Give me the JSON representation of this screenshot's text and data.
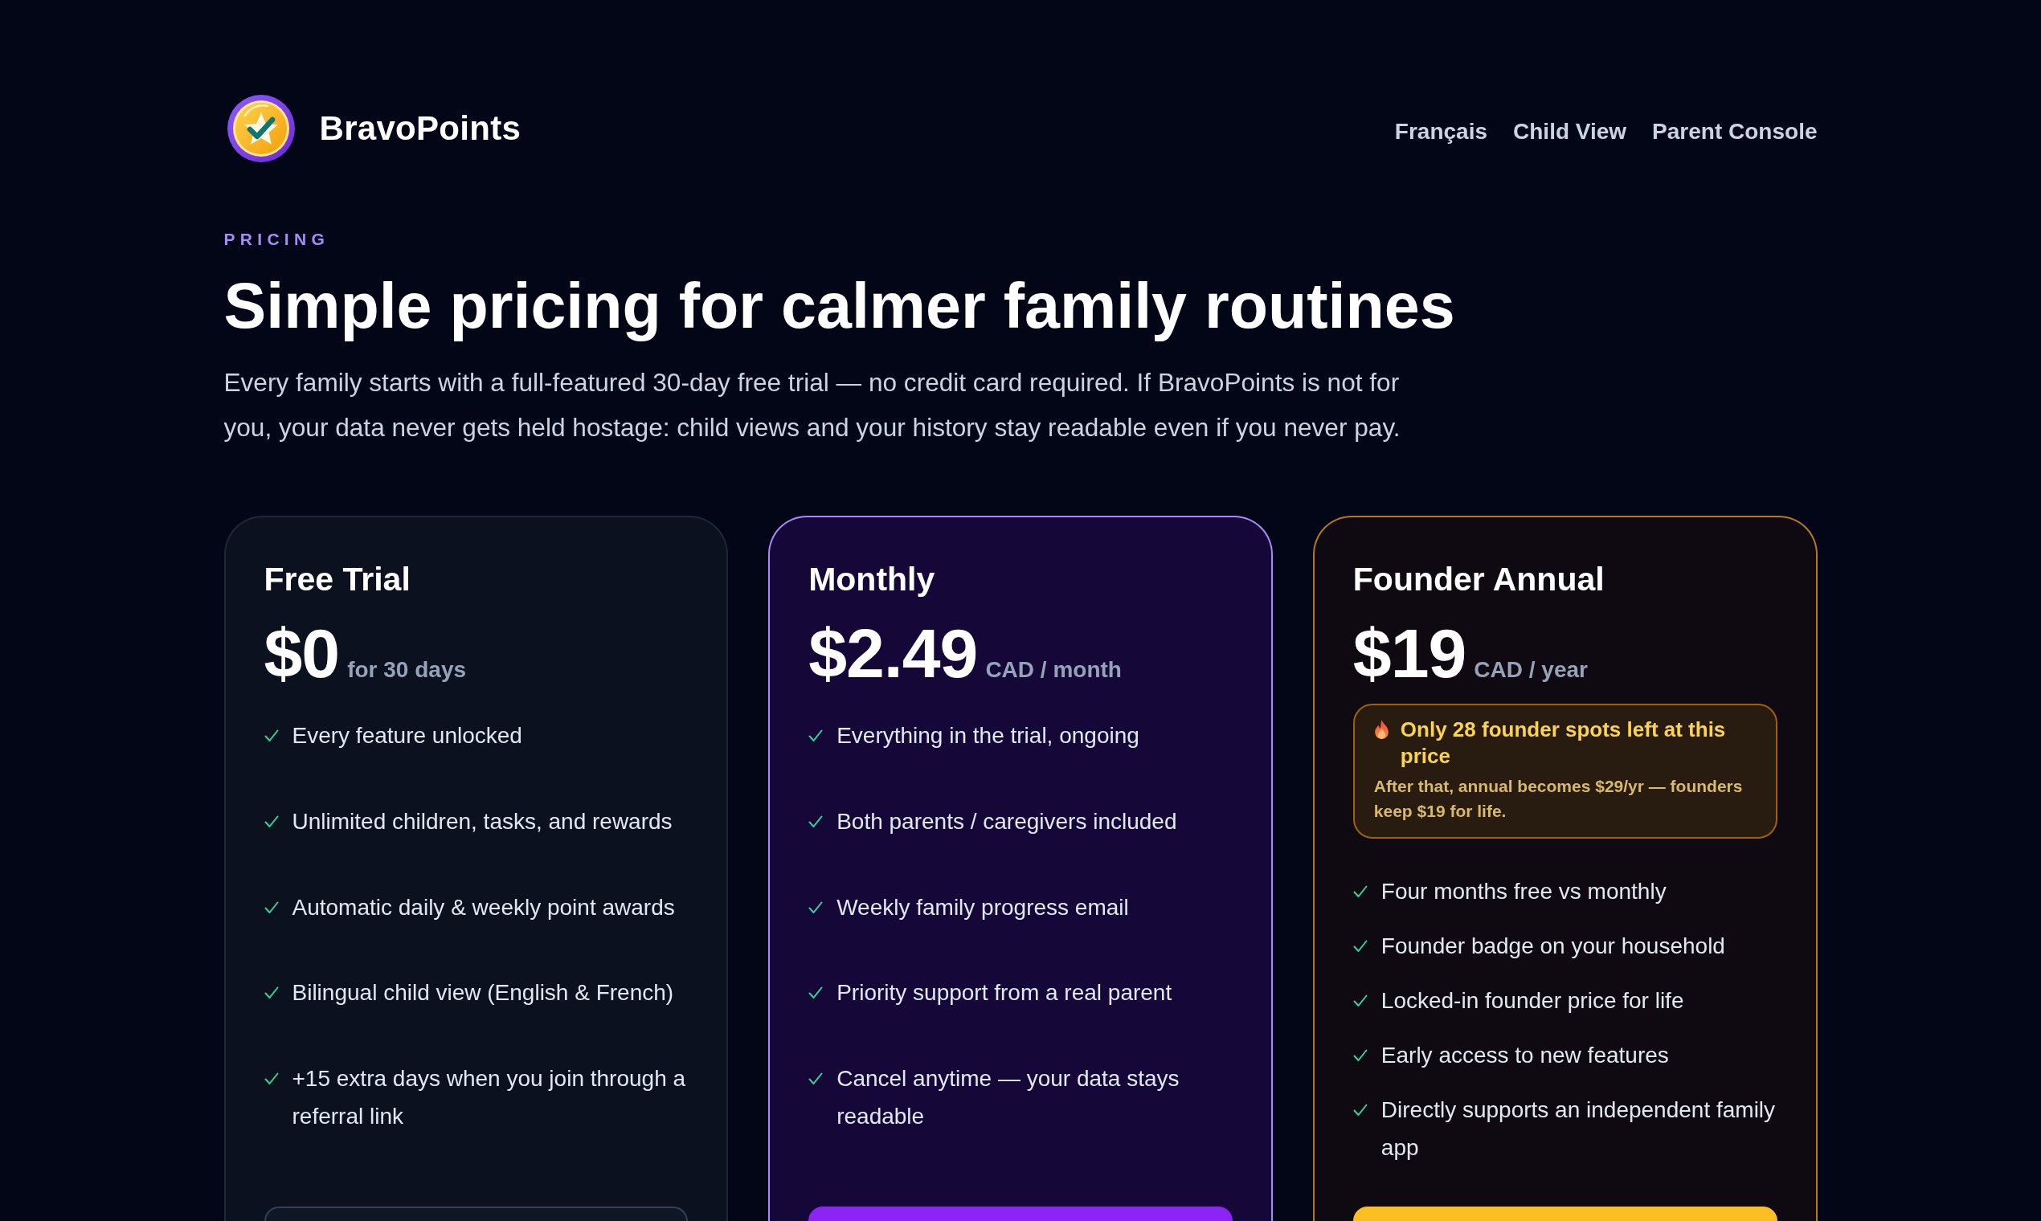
{
  "brand": {
    "name": "BravoPoints"
  },
  "nav": [
    "Français",
    "Child View",
    "Parent Console"
  ],
  "hero": {
    "eyebrow": "PRICING",
    "title": "Simple pricing for calmer family routines",
    "text": "Every family starts with a full-featured 30-day free trial — no credit card required. If BravoPoints is not for you, your data never gets held hostage: child views and your history stay readable even if you never pay."
  },
  "plans": [
    {
      "kind": "basic",
      "name": "Free Trial",
      "price": "$0",
      "period": "for 30 days",
      "features": [
        "Every feature unlocked",
        "Unlimited children, tasks, and rewards",
        "Automatic daily & weekly point awards",
        "Bilingual child view (English & French)",
        "+15 extra days when you join through a referral link"
      ]
    },
    {
      "kind": "featured",
      "name": "Monthly",
      "price": "$2.49",
      "period": "CAD / month",
      "features": [
        "Everything in the trial, ongoing",
        "Both parents / caregivers included",
        "Weekly family progress email",
        "Priority support from a real parent",
        "Cancel anytime — your data stays readable"
      ]
    },
    {
      "kind": "founder",
      "name": "Founder Annual",
      "price": "$19",
      "period": "CAD / year",
      "notice": {
        "title": "Only 28 founder spots left at this price",
        "text": "After that, annual becomes $29/yr — founders keep $19 for life."
      },
      "features": [
        "Four months free vs monthly",
        "Founder badge on your household",
        "Locked-in founder price for life",
        "Early access to new features",
        "Directly supports an independent family app"
      ]
    }
  ]
}
